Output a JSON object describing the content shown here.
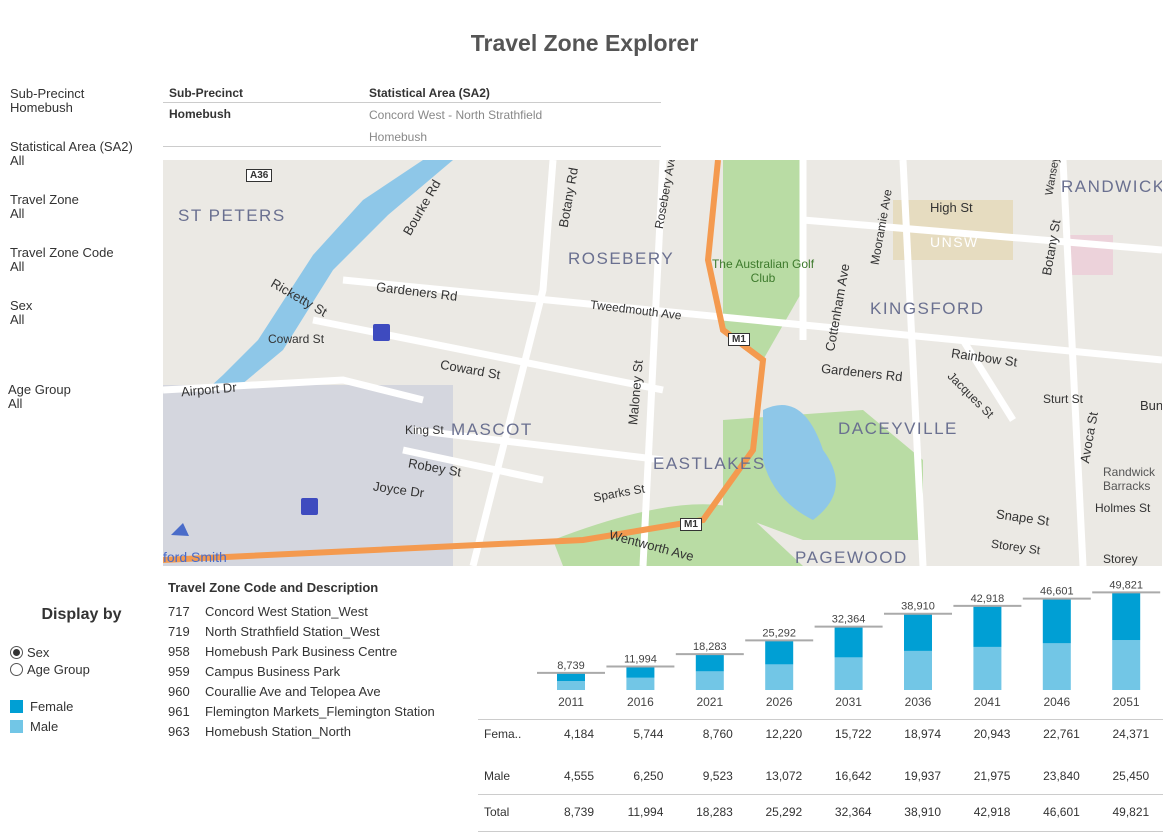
{
  "title": "Travel Zone Explorer",
  "filters": [
    {
      "label": "Sub-Precinct",
      "value": "Homebush"
    },
    {
      "label": "Statistical Area (SA2)",
      "value": "All"
    },
    {
      "label": "Travel Zone",
      "value": "All"
    },
    {
      "label": "Travel Zone Code",
      "value": "All"
    },
    {
      "label": "Sex",
      "value": "All"
    },
    {
      "label": "Age Group",
      "value": "All"
    }
  ],
  "sub_precinct_table": {
    "headers": [
      "Sub-Precinct",
      "Statistical Area (SA2)"
    ],
    "sub_precinct": "Homebush",
    "sa2": [
      "Concord West - North Strathfield",
      "Homebush"
    ]
  },
  "map": {
    "suburbs": [
      "ST PETERS",
      "ROSEBERY",
      "KINGSFORD",
      "RANDWICK",
      "UNSW",
      "MASCOT",
      "EASTLAKES",
      "DACEYVILLE",
      "PAGEWOOD"
    ],
    "streets": [
      "Bourke Rd",
      "Botany Rd",
      "Rosebery Ave",
      "Gardeners Rd",
      "Tweedmouth Ave",
      "Ricketty St",
      "Coward St",
      "Coward St",
      "Airport Dr",
      "King St",
      "Robey St",
      "Joyce Dr",
      "Maloney St",
      "Sparks St",
      "Wentworth Ave",
      "Cottenham Ave",
      "Mooramie Ave",
      "High St",
      "Botany St",
      "Rainbow St",
      "Gardeners Rd",
      "Jacques St",
      "Sturt St",
      "Avoca St",
      "Snape St",
      "Storey St",
      "Holmes St",
      "Bun",
      "Wansey",
      "The Australian Golf Club",
      "Randwick Barracks",
      "ford Smith",
      "Storey"
    ],
    "shields": [
      "A36",
      "M1",
      "M1"
    ]
  },
  "travel_zones": {
    "heading": "Travel Zone Code and Description",
    "items": [
      {
        "code": "717",
        "desc": "Concord West Station_West"
      },
      {
        "code": "719",
        "desc": "North Strathfield Station_West"
      },
      {
        "code": "958",
        "desc": "Homebush Park Business Centre"
      },
      {
        "code": "959",
        "desc": "Campus Business Park"
      },
      {
        "code": "960",
        "desc": "Courallie Ave and Telopea Ave"
      },
      {
        "code": "961",
        "desc": "Flemington Markets_Flemington Station"
      },
      {
        "code": "963",
        "desc": "Homebush Station_North"
      }
    ]
  },
  "display_by": {
    "heading": "Display by",
    "options": [
      "Sex",
      "Age Group"
    ],
    "selected": "Sex",
    "legend": [
      {
        "label": "Female",
        "color": "#009fd4"
      },
      {
        "label": "Male",
        "color": "#72c6e6"
      }
    ]
  },
  "chart_data": {
    "type": "bar",
    "stacked": true,
    "categories": [
      "2011",
      "2016",
      "2021",
      "2026",
      "2031",
      "2036",
      "2041",
      "2046",
      "2051"
    ],
    "series": [
      {
        "name": "Male",
        "row_label": "Male",
        "color": "#72c6e6",
        "values": [
          4555,
          6250,
          9523,
          13072,
          16642,
          19937,
          21975,
          23840,
          25450
        ]
      },
      {
        "name": "Female",
        "row_label": "Fema..",
        "color": "#009fd4",
        "values": [
          4184,
          5744,
          8760,
          12220,
          15722,
          18974,
          20943,
          22761,
          24371
        ]
      }
    ],
    "totals": [
      8739,
      11994,
      18283,
      25292,
      32364,
      38910,
      42918,
      46601,
      49821
    ],
    "total_labels": [
      "8,739",
      "11,994",
      "18,283",
      "25,292",
      "32,364",
      "38,910",
      "42,918",
      "46,601",
      "49,821"
    ],
    "table": {
      "female": [
        "4,184",
        "5,744",
        "8,760",
        "12,220",
        "15,722",
        "18,974",
        "20,943",
        "22,761",
        "24,371"
      ],
      "male": [
        "4,555",
        "6,250",
        "9,523",
        "13,072",
        "16,642",
        "19,937",
        "21,975",
        "23,840",
        "25,450"
      ],
      "total_label": "Total",
      "total": [
        "8,739",
        "11,994",
        "18,283",
        "25,292",
        "32,364",
        "38,910",
        "42,918",
        "46,601",
        "49,821"
      ]
    },
    "ylim": [
      0,
      50000
    ]
  }
}
